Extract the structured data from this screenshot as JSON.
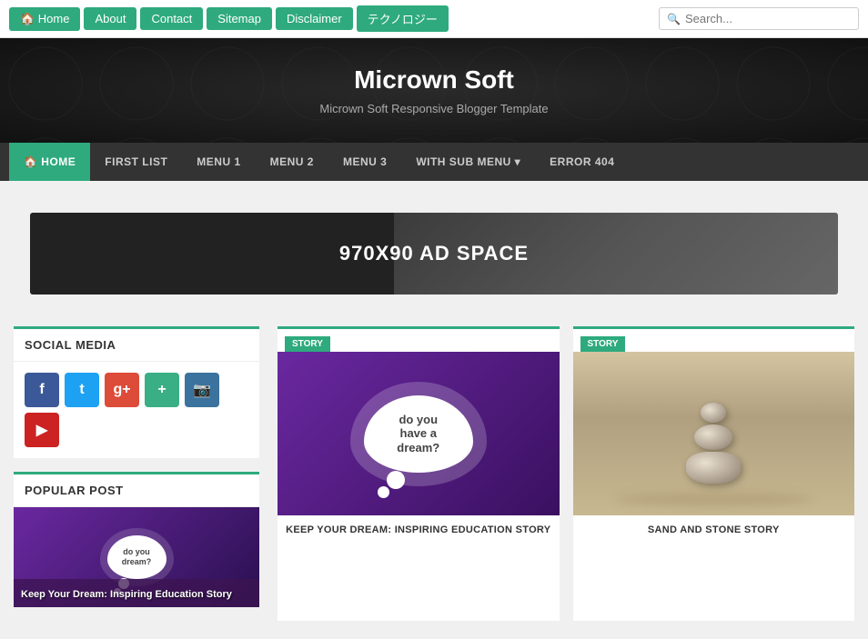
{
  "topbar": {
    "nav": [
      {
        "label": "🏠 Home",
        "key": "home"
      },
      {
        "label": "About",
        "key": "about"
      },
      {
        "label": "Contact",
        "key": "contact"
      },
      {
        "label": "Sitemap",
        "key": "sitemap"
      },
      {
        "label": "Disclaimer",
        "key": "disclaimer"
      },
      {
        "label": "テクノロジー",
        "key": "tech"
      }
    ],
    "search_placeholder": "Search..."
  },
  "header": {
    "title": "Micrown Soft",
    "subtitle": "Micrown Soft Responsive Blogger Template"
  },
  "mainnav": {
    "items": [
      {
        "label": "🏠 HOME",
        "key": "home",
        "active": true
      },
      {
        "label": "FIRST LIST",
        "key": "firstlist"
      },
      {
        "label": "MENU 1",
        "key": "menu1"
      },
      {
        "label": "MENU 2",
        "key": "menu2"
      },
      {
        "label": "MENU 3",
        "key": "menu3"
      },
      {
        "label": "WITH SUB MENU ▾",
        "key": "submenu"
      },
      {
        "label": "ERROR 404",
        "key": "error404"
      }
    ]
  },
  "adbanner": {
    "text": "970X90 AD SPACE"
  },
  "sidebar": {
    "social_title": "SOCIAL MEDIA",
    "social_icons": [
      {
        "name": "facebook",
        "letter": "f",
        "class": "si-facebook"
      },
      {
        "name": "twitter",
        "letter": "t",
        "class": "si-twitter"
      },
      {
        "name": "google",
        "letter": "g+",
        "class": "si-google"
      },
      {
        "name": "plus",
        "letter": "+",
        "class": "si-plus"
      },
      {
        "name": "instagram",
        "letter": "📷",
        "class": "si-instagram"
      },
      {
        "name": "youtube",
        "letter": "▶",
        "class": "si-youtube"
      }
    ],
    "popular_title": "POPULAR POST",
    "popular_post_label": "Keep Your Dream: Inspiring Education Story"
  },
  "posts": [
    {
      "tag": "STORY",
      "type": "dream",
      "title": "KEEP YOUR DREAM: INSPIRING EDUCATION STORY",
      "dream_line1": "do",
      "dream_line2": "you",
      "dream_line3": "have a",
      "dream_line4": "dream?"
    },
    {
      "tag": "STORY",
      "type": "stone",
      "title": "SAND AND STONE STORY"
    }
  ]
}
